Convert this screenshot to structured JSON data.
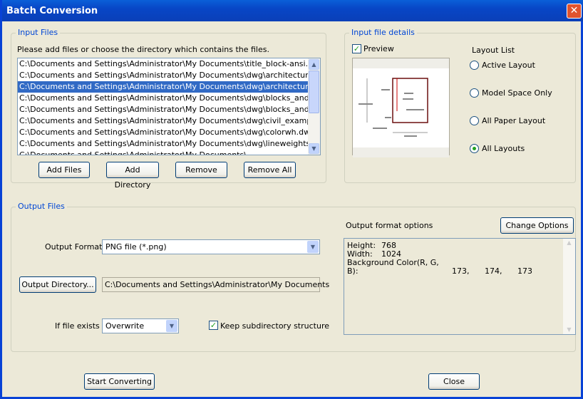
{
  "window": {
    "title": "Batch Conversion",
    "close_glyph": "✕"
  },
  "input_files": {
    "legend": "Input Files",
    "instruction": "Please add files or choose the directory which contains the files.",
    "files": [
      "C:\\Documents and Settings\\Administrator\\My Documents\\title_block-ansi.dwg",
      "C:\\Documents and Settings\\Administrator\\My Documents\\dwg\\architectural_-_annot",
      "C:\\Documents and Settings\\Administrator\\My Documents\\dwg\\architectural_example",
      "C:\\Documents and Settings\\Administrator\\My Documents\\dwg\\blocks_and_tables_-_",
      "C:\\Documents and Settings\\Administrator\\My Documents\\dwg\\blocks_and_tables_-_",
      "C:\\Documents and Settings\\Administrator\\My Documents\\dwg\\civil_example-imperial",
      "C:\\Documents and Settings\\Administrator\\My Documents\\dwg\\colorwh.dwg",
      "C:\\Documents and Settings\\Administrator\\My Documents\\dwg\\lineweights.dwg",
      "C:\\Documents and Settings\\Administrator\\My Documents\\..."
    ],
    "selected_index": 2,
    "buttons": {
      "add_files": "Add Files",
      "add_directory": "Add Directory",
      "remove": "Remove",
      "remove_all": "Remove All"
    }
  },
  "details": {
    "legend": "Input file details",
    "preview_label": "Preview",
    "preview_checked": true,
    "layout_list_label": "Layout List",
    "layouts": [
      "Active Layout",
      "Model Space Only",
      "All Paper Layout",
      "All Layouts"
    ],
    "selected_layout": "All Layouts"
  },
  "output": {
    "legend": "Output Files",
    "format_label": "Output Format",
    "format_value": "PNG file (*.png)",
    "dir_button": "Output Directory...",
    "dir_value": "C:\\Documents and Settings\\Administrator\\My Documents",
    "exists_label": "If file exists",
    "exists_value": "Overwrite",
    "keep_label": "Keep subdirectory structure",
    "keep_checked": true,
    "options_label": "Output format options",
    "change_options": "Change Options",
    "options": {
      "height_label": "Height:",
      "height": "768",
      "width_label": "Width:",
      "width": "1024",
      "bg_label": "Background Color(R, G, B):",
      "r": "173,",
      "g": "174,",
      "b": "173"
    }
  },
  "footer": {
    "start": "Start Converting",
    "close": "Close"
  }
}
